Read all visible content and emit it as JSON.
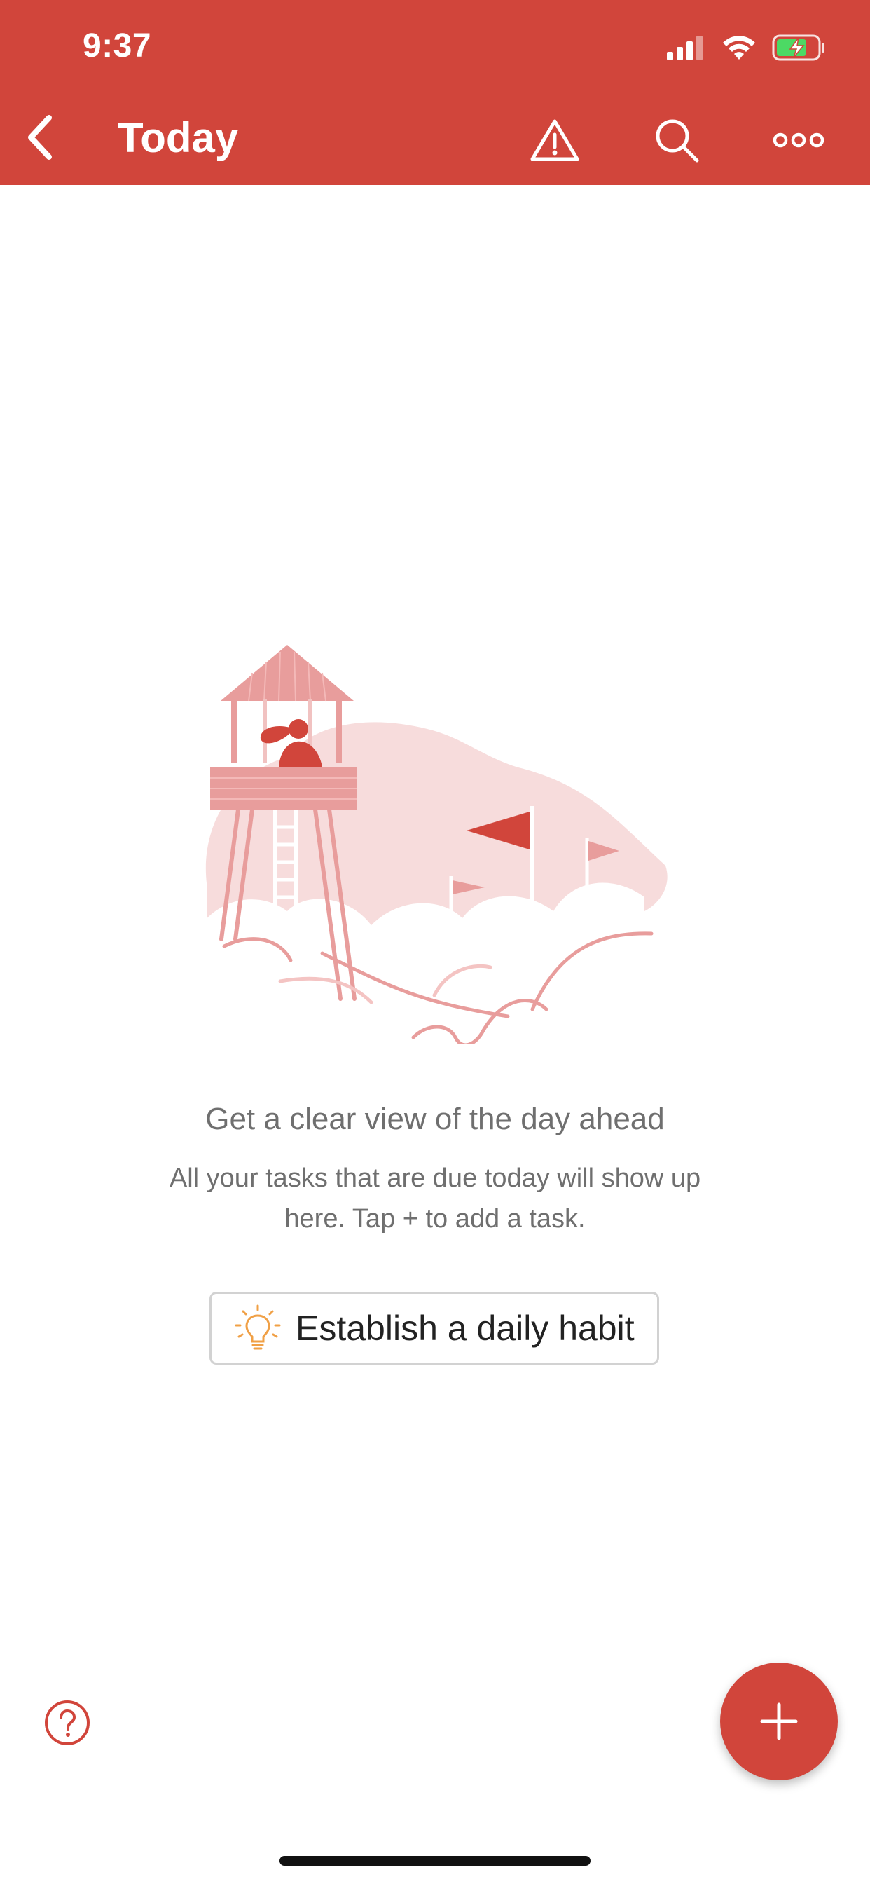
{
  "status_bar": {
    "time": "9:37"
  },
  "nav": {
    "title": "Today",
    "back_icon": "chevron-left-icon",
    "actions": [
      {
        "icon": "warning-icon"
      },
      {
        "icon": "search-icon"
      },
      {
        "icon": "more-horizontal-icon"
      }
    ]
  },
  "empty_state": {
    "title": "Get a clear view of the day ahead",
    "description": "All your tasks that are due today will show up here. Tap + to add a task.",
    "habit_button_label": "Establish a daily habit",
    "habit_button_icon": "lightbulb-icon"
  },
  "bottom": {
    "help_icon": "help-circle-icon",
    "fab_icon": "plus-icon"
  },
  "colors": {
    "brand": "#d1453b",
    "text_secondary": "#6f6f6f",
    "bulb_accent": "#f0a046"
  }
}
